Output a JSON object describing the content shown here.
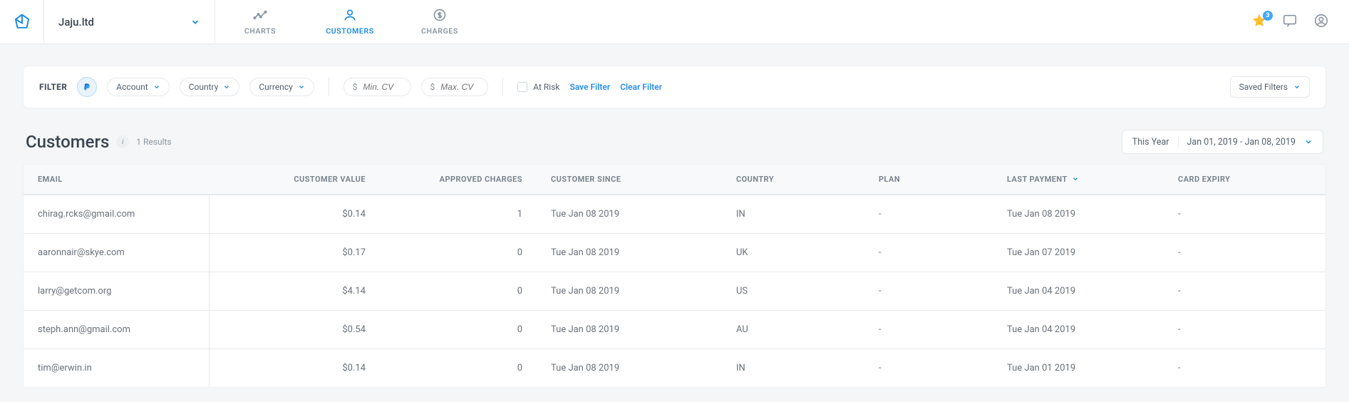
{
  "org": "Jaju.ltd",
  "nav": {
    "charts": "CHARTS",
    "customers": "CUSTOMERS",
    "charges": "CHARGES"
  },
  "notif_count": "3",
  "filter": {
    "title": "FILTER",
    "account": "Account",
    "country": "Country",
    "currency": "Currency",
    "min_ph": "Min. CV",
    "max_ph": "Max. CV",
    "risk": "At Risk",
    "save": "Save Filter",
    "clear": "Clear Filter",
    "saved": "Saved Filters"
  },
  "heading": "Customers",
  "results": "1 Results",
  "date": {
    "preset": "This Year",
    "range": "Jan 01, 2019 - Jan 08, 2019"
  },
  "columns": {
    "email": "EMAIL",
    "cv": "CUSTOMER VALUE",
    "appr": "APPROVED CHARGES",
    "since": "CUSTOMER SINCE",
    "country": "COUNTRY",
    "plan": "PLAN",
    "last": "LAST PAYMENT",
    "expiry": "CARD EXPIRY"
  },
  "rows": [
    {
      "email": "chirag.rcks@gmail.com",
      "cv": "$0.14",
      "appr": "1",
      "since": "Tue Jan 08 2019",
      "country": "IN",
      "plan": "-",
      "last": "Tue Jan 08 2019",
      "expiry": "-"
    },
    {
      "email": "aaronnair@skye.com",
      "cv": "$0.17",
      "appr": "0",
      "since": "Tue Jan 08 2019",
      "country": "UK",
      "plan": "-",
      "last": "Tue Jan 07 2019",
      "expiry": "-"
    },
    {
      "email": "larry@getcom.org",
      "cv": "$4.14",
      "appr": "0",
      "since": "Tue Jan 08 2019",
      "country": "US",
      "plan": "-",
      "last": "Tue Jan 04 2019",
      "expiry": "-"
    },
    {
      "email": "steph.ann@gmail.com",
      "cv": "$0.54",
      "appr": "0",
      "since": "Tue Jan 08 2019",
      "country": "AU",
      "plan": "-",
      "last": "Tue Jan 04 2019",
      "expiry": "-"
    },
    {
      "email": "tim@erwin.in",
      "cv": "$0.14",
      "appr": "0",
      "since": "Tue Jan 08 2019",
      "country": "IN",
      "plan": "-",
      "last": "Tue Jan 01 2019",
      "expiry": "-"
    }
  ]
}
